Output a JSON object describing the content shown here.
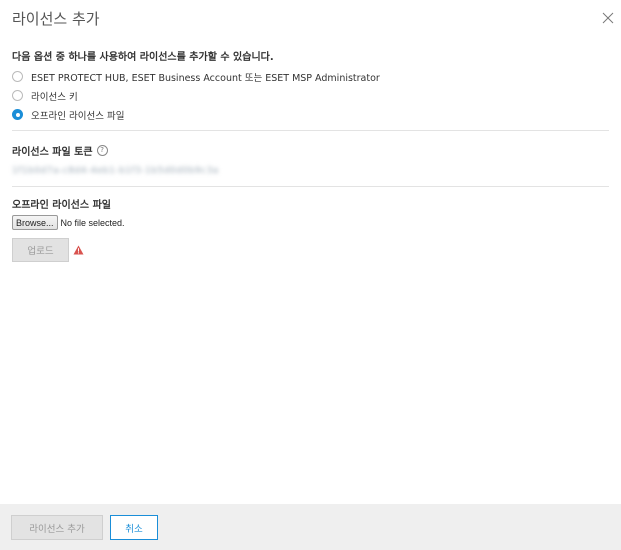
{
  "dialog": {
    "title": "라이선스 추가",
    "close_icon": "close-icon"
  },
  "options": {
    "prompt": "다음 옵션 중 하나를 사용하여 라이선스를 추가할 수 있습니다.",
    "items": [
      {
        "label": "ESET PROTECT HUB, ESET Business Account 또는 ESET MSP Administrator",
        "checked": false
      },
      {
        "label": "라이선스 키",
        "checked": false
      },
      {
        "label": "오프라인 라이선스 파일",
        "checked": true
      }
    ]
  },
  "token": {
    "label": "라이선스 파일 토큰",
    "help_icon": "question-circle-icon",
    "value": "1f1b0d7a-c8d4-4eb1-b1f3-1b5d0d0b9c3a"
  },
  "file": {
    "label": "오프라인 라이선스 파일",
    "browse_label": "Browse...",
    "status": "No file selected.",
    "upload_label": "업로드",
    "warning_icon": "warning-triangle-icon"
  },
  "footer": {
    "add_label": "라이선스 추가",
    "cancel_label": "취소"
  },
  "colors": {
    "accent": "#1a8ed8",
    "warning": "#d9534f"
  }
}
